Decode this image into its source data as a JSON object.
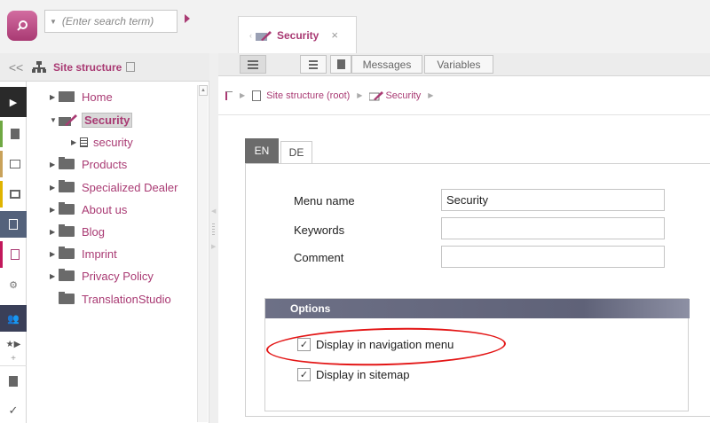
{
  "search": {
    "placeholder": "(Enter search term)"
  },
  "editor_tab": {
    "label": "Security",
    "close": "×"
  },
  "sidebar": {
    "collapse": "<<",
    "title": "Site structure",
    "tree": [
      {
        "label": "Home",
        "type": "folder",
        "expanded": false
      },
      {
        "label": "Security",
        "type": "folder",
        "expanded": true,
        "selected": true
      },
      {
        "label": "security",
        "type": "page"
      },
      {
        "label": "Products",
        "type": "folder"
      },
      {
        "label": "Specialized Dealer",
        "type": "folder"
      },
      {
        "label": "About us",
        "type": "folder"
      },
      {
        "label": "Blog",
        "type": "folder"
      },
      {
        "label": "Imprint",
        "type": "folder"
      },
      {
        "label": "Privacy Policy",
        "type": "folder"
      },
      {
        "label": "TranslationStudio",
        "type": "folder"
      }
    ]
  },
  "toolbar": {
    "messages": "Messages",
    "variables": "Variables"
  },
  "breadcrumb": {
    "root": "Site structure (root)",
    "current": "Security"
  },
  "languages": {
    "active": "EN",
    "other": "DE"
  },
  "form": {
    "menu_name_label": "Menu name",
    "menu_name_value": "Security",
    "keywords_label": "Keywords",
    "keywords_value": "",
    "comment_label": "Comment",
    "comment_value": ""
  },
  "options": {
    "title": "Options",
    "display_in_navigation": {
      "label": "Display in navigation menu",
      "checked": true
    },
    "display_in_sitemap": {
      "label": "Display in sitemap",
      "checked": true
    }
  },
  "colors": {
    "brand": "#a93a73",
    "options_header": "#6d7086",
    "annotation": "#e31515"
  }
}
